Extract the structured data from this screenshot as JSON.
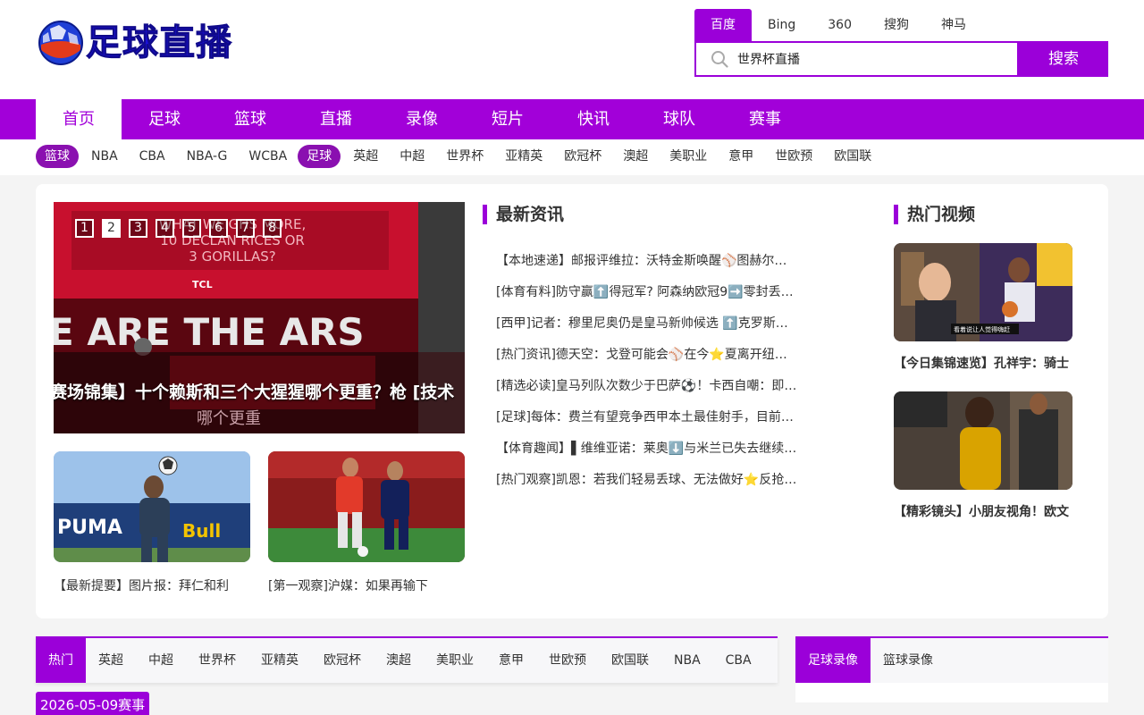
{
  "logo": {
    "text": "足球直播"
  },
  "search": {
    "tabs": [
      "百度",
      "Bing",
      "360",
      "搜狗",
      "神马"
    ],
    "active_tab": 0,
    "value": "世界杯直播",
    "button": "搜索"
  },
  "mainnav": {
    "items": [
      "首页",
      "足球",
      "篮球",
      "直播",
      "录像",
      "短片",
      "快讯",
      "球队",
      "赛事"
    ],
    "active": 0
  },
  "subnav": {
    "items": [
      "篮球",
      "NBA",
      "CBA",
      "NBA-G",
      "WCBA",
      "足球",
      "英超",
      "中超",
      "世界杯",
      "亚精英",
      "欧冠杯",
      "澳超",
      "美职业",
      "意甲",
      "世欧预",
      "欧国联"
    ],
    "pills": [
      0,
      5
    ]
  },
  "slider": {
    "dots": [
      "1",
      "2",
      "3",
      "4",
      "5",
      "6",
      "7",
      "8"
    ],
    "active_dot": 1,
    "caption": "赛场锦集】十个赖斯和三个大猩猩哪个更重？枪  [技术",
    "bg_text_1": "WHAT WEIGHS MORE,",
    "bg_text_2": "10 DECLAN RICES OR",
    "bg_text_3": "3 GORILLAS?",
    "bg_brand": "TCL",
    "bg_banner": "E ARE THE ARS",
    "bg_sub": "哪个更重"
  },
  "thumbs": [
    {
      "caption": "【最新提要】图片报：拜仁和利",
      "brand1": "PUMA",
      "brand2": "Bull"
    },
    {
      "caption": "[第一观察]沪媒：如果再输下"
    }
  ],
  "news": {
    "title": "最新资讯",
    "items": [
      "【本地速递】邮报评维拉：沃特金斯唤醒⚾图赫尔…",
      "[体育有料]防守赢⬆️得冠军? 阿森纳欧冠9➡️零封丢…",
      "[西甲]记者：穆里尼奥仍是皇马新帅候选 ⬆️克罗斯…",
      "[热门资讯]德天空：戈登可能会⚾在今⭐夏离开纽…",
      "[精选必读]皇马列队次数少于巴萨⚽！卡西自嘲：即…",
      "[足球]每体：费兰有望竞争西甲本土最佳射手，目前…",
      "【体育趣闻】▌维维亚诺：莱奥⬇️与米兰已失去继续…",
      "[热门观察]凯恩：若我们轻易丢球、无法做好⭐反抢…"
    ]
  },
  "videos": {
    "title": "热门视频",
    "items": [
      {
        "caption": "【今日集锦速览】孔祥宇：骑士",
        "overlay": "看着说让人觉得嗨赶"
      },
      {
        "caption": "【精彩镜头】小朋友视角！欧文"
      }
    ]
  },
  "bottom_tabs": {
    "items": [
      "热门",
      "英超",
      "中超",
      "世界杯",
      "亚精英",
      "欧冠杯",
      "澳超",
      "美职业",
      "意甲",
      "世欧预",
      "欧国联",
      "NBA",
      "CBA"
    ],
    "active": 0
  },
  "replay_tabs": {
    "items": [
      "足球录像",
      "篮球录像"
    ],
    "active": 0
  },
  "date_badge": "2026-05-09赛事",
  "colors": {
    "accent": "#9b00d9",
    "logo_text": "#1a11d6"
  }
}
